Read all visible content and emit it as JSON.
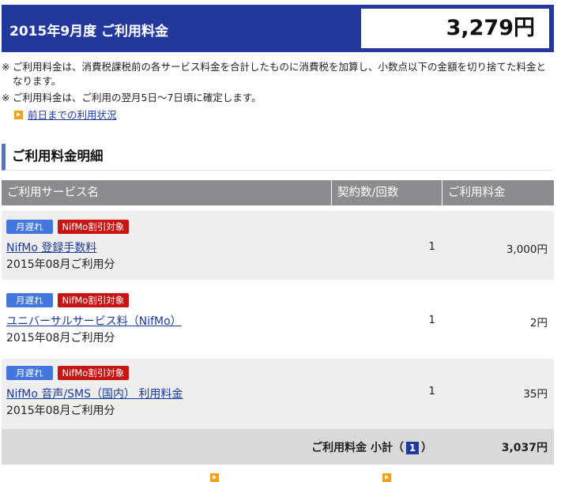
{
  "header": {
    "title": "2015年9月度 ご利用料金",
    "total": "3,279円"
  },
  "notes": {
    "mark": "※",
    "note1": "ご利用料金は、消費税課税前の各サービス料金を合計したものに消費税を加算し、小数点以下の金額を切り捨てた料金となります。",
    "note2": "ご利用料金は、ご利用の翌月5日～7日頃に確定します。",
    "usage_link": "前日までの利用状況"
  },
  "section_title": "ご利用料金明細",
  "table": {
    "headers": [
      "ご利用サービス名",
      "契約数/回数",
      "ご利用料金"
    ],
    "rows": [
      {
        "badges": [
          "月遅れ",
          "NifMo割引対象"
        ],
        "service": "NifMo 登録手数料",
        "period": "2015年08月ご利用分",
        "count": "1",
        "fee": "3,000円"
      },
      {
        "badges": [
          "月遅れ",
          "NifMo割引対象"
        ],
        "service": "ユニバーサルサービス料（NifMo）",
        "period": "2015年08月ご利用分",
        "count": "1",
        "fee": "2円"
      },
      {
        "badges": [
          "月遅れ",
          "NifMo割引対象"
        ],
        "service": "NifMo 音声/SMS（国内） 利用料金",
        "period": "2015年08月ご利用分",
        "count": "1",
        "fee": "35円"
      }
    ],
    "subtotal": {
      "label": "ご利用料金 小計（",
      "page": "1",
      "close": "）",
      "amount": "3,037円"
    }
  }
}
